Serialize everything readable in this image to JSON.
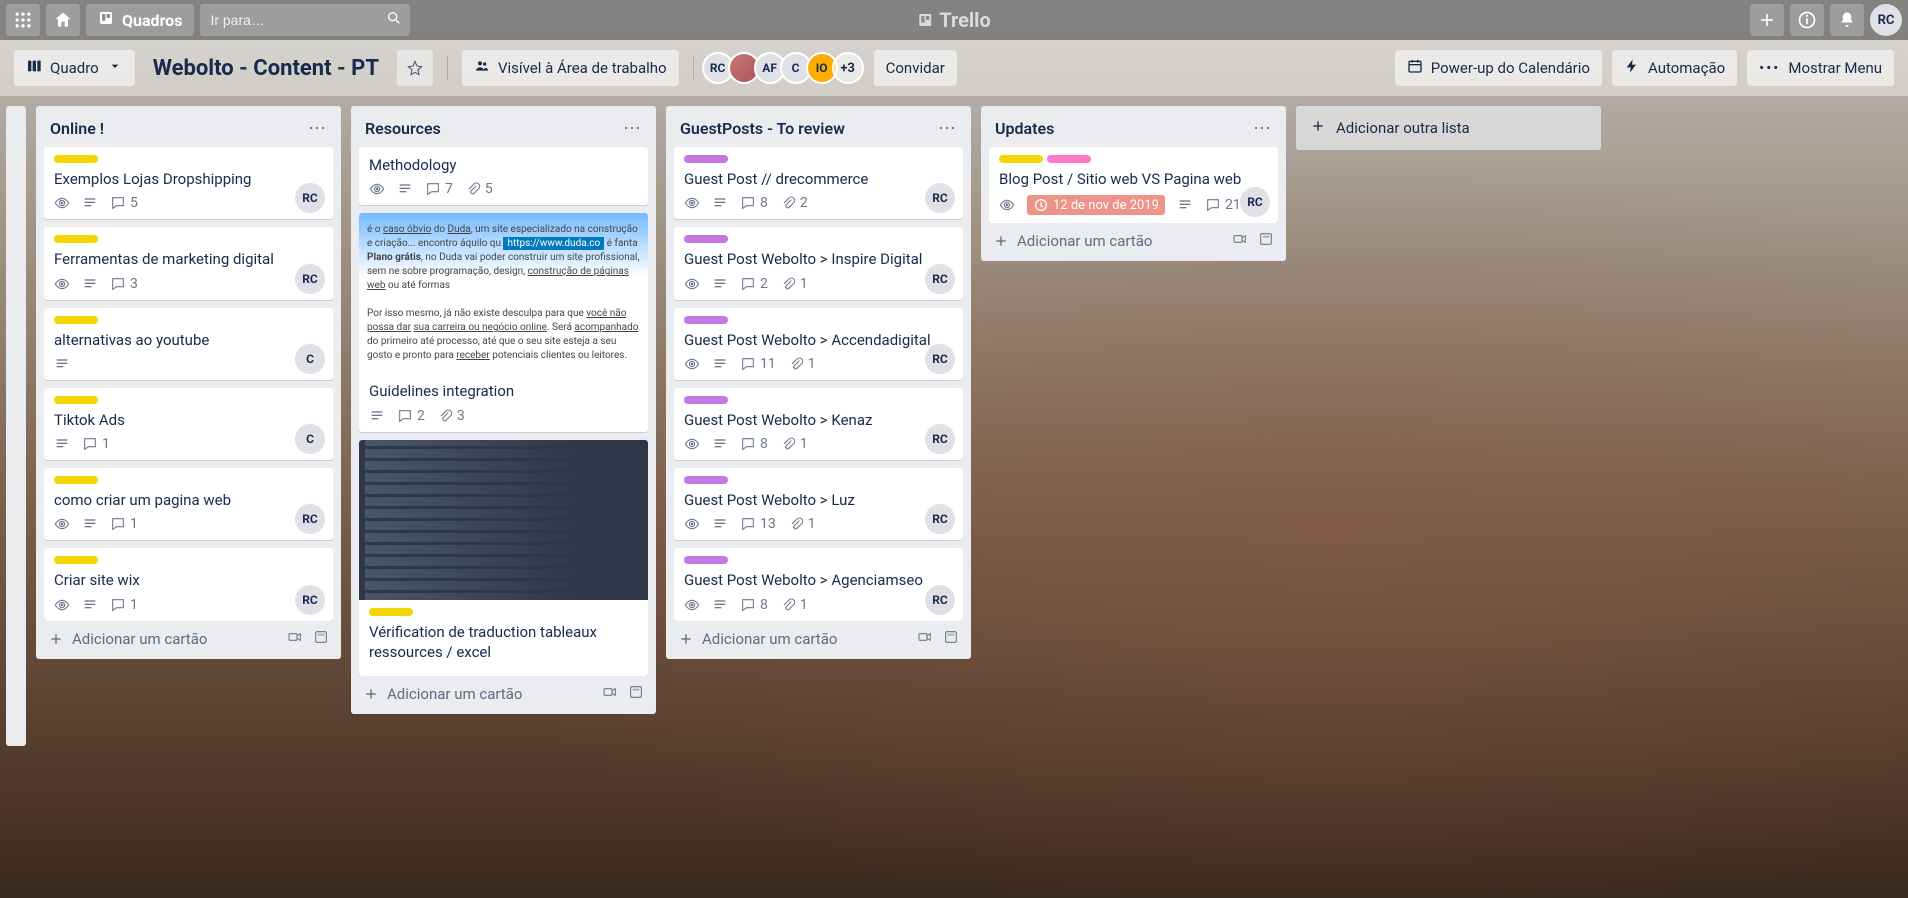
{
  "topbar": {
    "boards_label": "Quadros",
    "search_placeholder": "Ir para…",
    "logo_text": "Trello",
    "user_initials": "RC"
  },
  "boardbar": {
    "view_label": "Quadro",
    "title": "Webolto - Content - PT",
    "visibility": "Visível à Área de trabalho",
    "members": [
      {
        "text": "RC",
        "cls": "rc"
      },
      {
        "text": "",
        "cls": "photo"
      },
      {
        "text": "AF",
        "cls": "af"
      },
      {
        "text": "C",
        "cls": "c"
      },
      {
        "text": "IO",
        "cls": "io"
      }
    ],
    "more_members": "+3",
    "invite": "Convidar",
    "calendar": "Power-up do Calendário",
    "automation": "Automação",
    "show_menu": "Mostrar Menu"
  },
  "lists": [
    {
      "title": "Online !",
      "cards": [
        {
          "labels": [
            "yellow"
          ],
          "title": "Exemplos Lojas Dropshipping",
          "watch": true,
          "desc": true,
          "comments": 5,
          "member": "RC"
        },
        {
          "labels": [
            "yellow"
          ],
          "title": "Ferramentas de marketing digital",
          "watch": true,
          "desc": true,
          "comments": 3,
          "member": "RC"
        },
        {
          "labels": [
            "yellow"
          ],
          "title": "alternativas ao youtube",
          "desc": true,
          "member": "C"
        },
        {
          "labels": [
            "yellow"
          ],
          "title": "Tiktok Ads",
          "desc": true,
          "comments": 1,
          "member": "C"
        },
        {
          "labels": [
            "yellow"
          ],
          "title": "como criar um pagina web",
          "watch": true,
          "desc": true,
          "comments": 1,
          "member": "RC"
        },
        {
          "labels": [
            "yellow"
          ],
          "title": "Criar site wix",
          "watch": true,
          "desc": true,
          "comments": 1,
          "member": "RC"
        }
      ],
      "add_card": "Adicionar um cartão"
    },
    {
      "title": "Resources",
      "cards": [
        {
          "title": "Methodology",
          "watch": true,
          "desc": true,
          "comments": 7,
          "attach": 5
        },
        {
          "cover": "blue",
          "title": "Guidelines integration",
          "desc": true,
          "comments": 2,
          "attach": 3
        },
        {
          "cover": "dark",
          "labels": [
            "yellow"
          ],
          "title": "Vérification de traduction tableaux ressources / excel"
        }
      ],
      "add_card": "Adicionar um cartão"
    },
    {
      "title": "GuestPosts - To review",
      "cards": [
        {
          "labels": [
            "purple"
          ],
          "title": "Guest Post // drecommerce",
          "watch": true,
          "desc": true,
          "comments": 8,
          "attach": 2,
          "member": "RC"
        },
        {
          "labels": [
            "purple"
          ],
          "title": "Guest Post Webolto > Inspire Digital",
          "watch": true,
          "desc": true,
          "comments": 2,
          "attach": 1,
          "member": "RC"
        },
        {
          "labels": [
            "purple"
          ],
          "title": "Guest Post Webolto > Accendadigital",
          "watch": true,
          "desc": true,
          "comments": 11,
          "attach": 1,
          "member": "RC"
        },
        {
          "labels": [
            "purple"
          ],
          "title": "Guest Post Webolto > Kenaz",
          "watch": true,
          "desc": true,
          "comments": 8,
          "attach": 1,
          "member": "RC"
        },
        {
          "labels": [
            "purple"
          ],
          "title": "Guest Post Webolto > Luz",
          "watch": true,
          "desc": true,
          "comments": 13,
          "attach": 1,
          "member": "RC"
        },
        {
          "labels": [
            "purple"
          ],
          "title": "Guest Post Webolto > Agenciamseo",
          "watch": true,
          "desc": true,
          "comments": 8,
          "attach": 1,
          "member": "RC"
        }
      ],
      "add_card": "Adicionar um cartão"
    },
    {
      "title": "Updates",
      "cards": [
        {
          "labels": [
            "yellow",
            "pink"
          ],
          "title": "Blog Post / Sitio web VS Pagina web",
          "watch": true,
          "due": "12 de nov de 2019",
          "desc": true,
          "comments": 21,
          "member": "RC"
        }
      ],
      "add_card": "Adicionar um cartão"
    }
  ],
  "add_list": "Adicionar outra lista"
}
